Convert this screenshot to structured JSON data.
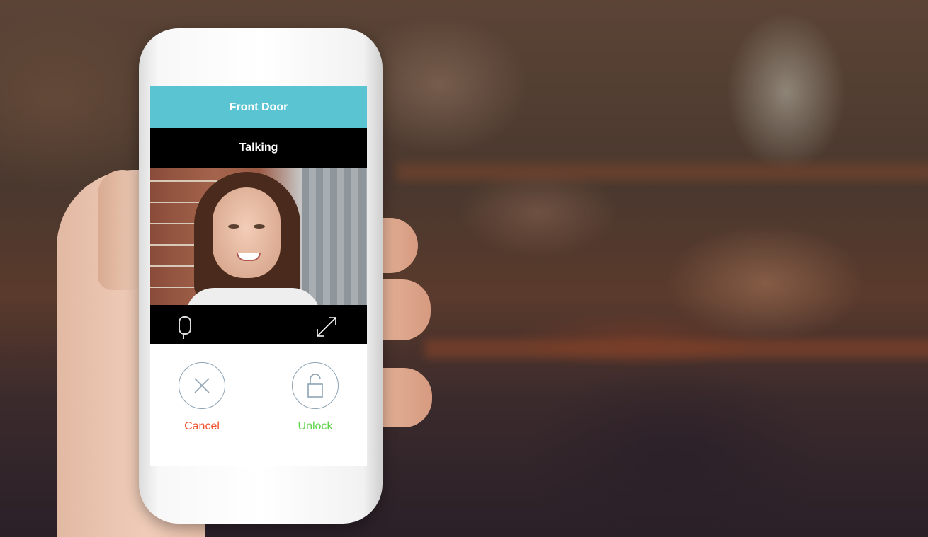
{
  "app": {
    "title": "Front Door",
    "status": "Talking"
  },
  "controls": {
    "mic_icon": "microphone-icon",
    "expand_icon": "expand-icon"
  },
  "actions": {
    "cancel_label": "Cancel",
    "unlock_label": "Unlock",
    "cancel_icon": "close-icon",
    "unlock_icon": "unlock-icon"
  },
  "colors": {
    "title_bar": "#5bc4d2",
    "cancel": "#f0522e",
    "unlock": "#5fd24a"
  }
}
